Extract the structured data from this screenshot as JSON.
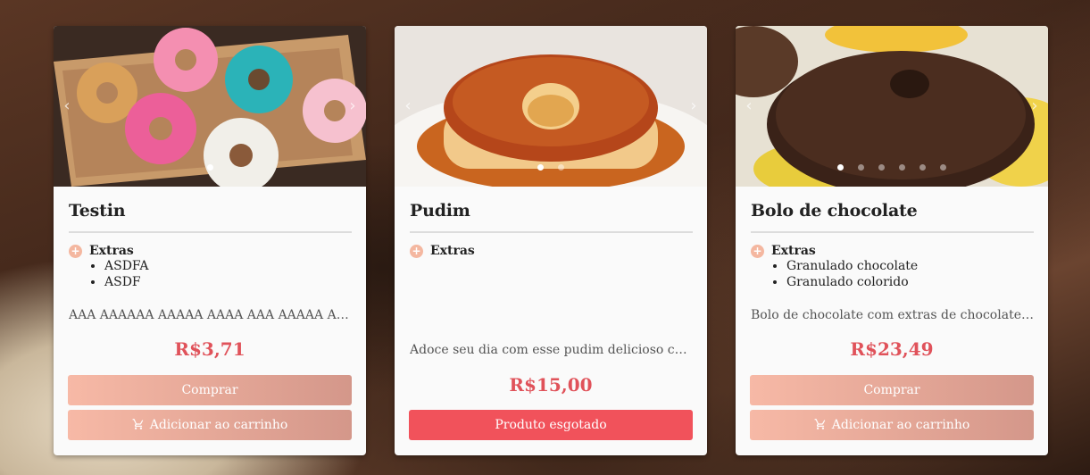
{
  "products": [
    {
      "name": "Testin",
      "extras_label": "Extras",
      "extras": [
        "ASDFA",
        "ASDF"
      ],
      "description": "AAA AAAAAA AAAAA AAAA AAA AAAAA AAAA",
      "price": "R$3,71",
      "buy_label": "Comprar",
      "cart_label": "Adicionar ao carrinho",
      "slides": 1
    },
    {
      "name": "Pudim",
      "extras_label": "Extras",
      "extras": [],
      "description": "Adoce seu dia com esse pudim delicioso com calda",
      "price": "R$15,00",
      "sold_out_label": "Produto esgotado",
      "slides": 2
    },
    {
      "name": "Bolo de chocolate",
      "extras_label": "Extras",
      "extras": [
        "Granulado chocolate",
        "Granulado colorido"
      ],
      "description": "Bolo de chocolate com extras de chocolate e granulado",
      "price": "R$23,49",
      "buy_label": "Comprar",
      "cart_label": "Adicionar ao carrinho",
      "slides": 6
    }
  ],
  "icons": {
    "prev": "chevron-left-icon",
    "next": "chevron-right-icon",
    "cart": "cart-icon",
    "plus": "plus-circle-icon"
  },
  "colors": {
    "price": "#e0525a",
    "sold_out": "#f1525b",
    "button_start": "#f7b9a6",
    "button_end": "#d4978a"
  }
}
